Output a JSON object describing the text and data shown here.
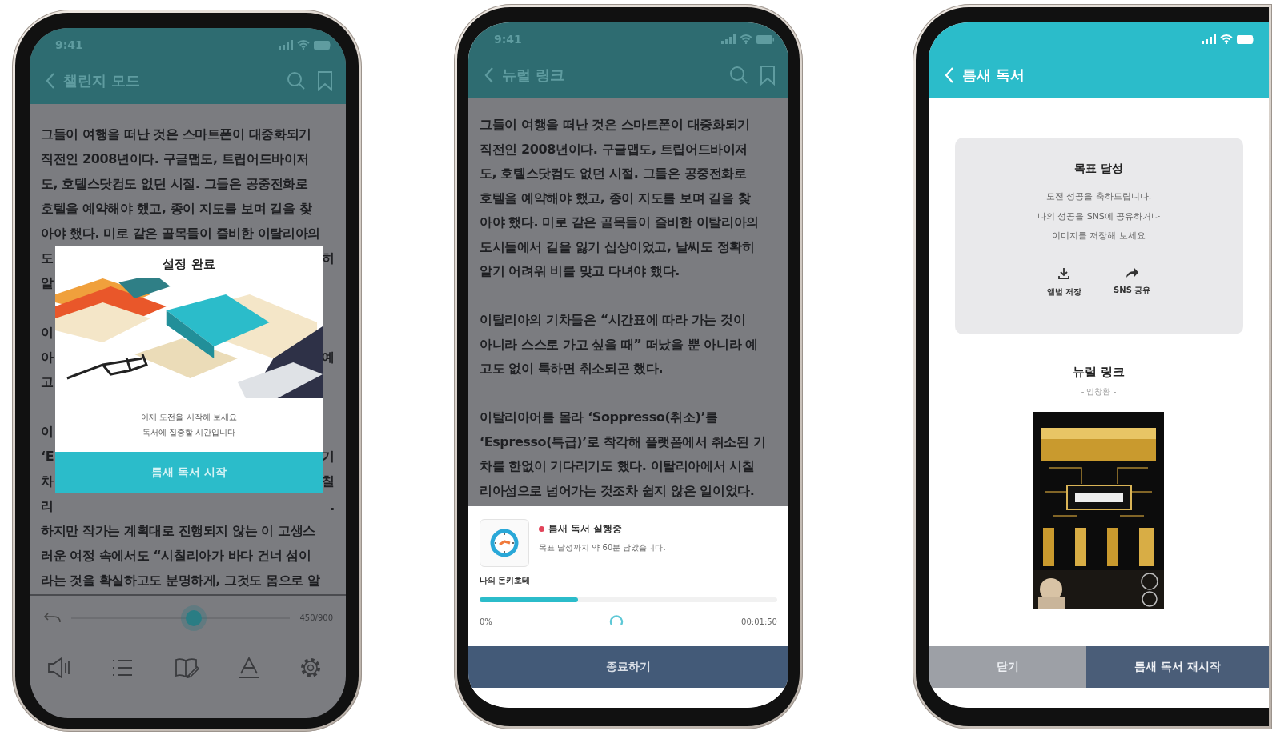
{
  "challenge_screen": {
    "status_time": "9:41",
    "title": "챌린지 모드",
    "paragraphs": [
      [
        {
          "text": "그들이 여행을 떠난 것은 스마트폰이 대중화되기"
        },
        {
          "text": "직전인 2008년이다. 구글맵도, 트립어드바이저"
        },
        {
          "text": "도, 호텔스닷컴도 없던 시절. 그들은 공중전화로"
        },
        {
          "text": "호텔을 예약해야 했고, 종이 지도를 보며 길을 찾"
        },
        {
          "text": "아야 했다. 미로 같은 골목들이 즐비한 이탈리아의"
        },
        {
          "left": "도",
          "right": "히"
        },
        {
          "left": "알"
        }
      ],
      [
        {
          "left": "이"
        },
        {
          "left": "아",
          "right": "예"
        },
        {
          "left": "고"
        }
      ],
      [
        {
          "left": "이"
        },
        {
          "left": "‘E",
          "right": "기"
        },
        {
          "left": "차",
          "right": "칠"
        },
        {
          "left": "리",
          "right": "."
        },
        {
          "text": "하지만 작가는 계획대로 진행되지 않는 이 고생스"
        },
        {
          "text": "러운 여정 속에서도 “시칠리아가 바다 건너 섬이"
        },
        {
          "text": "라는 것을 확실하고도 분명하게, 그것도 몸으로 알"
        }
      ]
    ],
    "dialog": {
      "title": "설정 완료",
      "message_lines": [
        "이제 도전을 시작해 보세요",
        "독서에 집중할 시간입니다"
      ],
      "button": "틈새 독서 시작"
    },
    "slider": {
      "level": 0.56,
      "reading": "450/900"
    }
  },
  "reading_screen": {
    "status_time": "9:41",
    "title": "뉴럴 링크",
    "paragraphs": [
      [
        {
          "text": "그들이 여행을 떠난 것은 스마트폰이 대중화되기"
        },
        {
          "text": "직전인 2008년이다. 구글맵도, 트립어드바이저"
        },
        {
          "text": "도, 호텔스닷컴도 없던 시절. 그들은 공중전화로"
        },
        {
          "text": "호텔을 예약해야 했고, 종이 지도를 보며 길을 찾"
        },
        {
          "text": "아야 했다. 미로 같은 골목들이 즐비한 이탈리아의"
        },
        {
          "text": "도시들에서 길을 잃기 십상이었고, 날씨도 정확히"
        },
        {
          "text": "알기 어려워 비를 맞고 다녀야 했다."
        }
      ],
      [
        {
          "text": "이탈리아의 기차들은 “시간표에 따라 가는 것이"
        },
        {
          "text": "아니라 스스로 가고 싶을 때” 떠났을 뿐 아니라 예"
        },
        {
          "text": "고도 없이 툭하면 취소되곤 했다."
        }
      ],
      [
        {
          "text": "이탈리아어를 몰라 ‘Soppresso(취소)’를"
        },
        {
          "text": "‘Espresso(특급)’로 착각해 플랫폼에서 취소된 기"
        },
        {
          "text": "차를 한없이 기다리기도 했다. 이탈리아에서 시칠"
        },
        {
          "text": "리아섬으로 넘어가는 것조차 쉽지 않은 일이었다."
        }
      ]
    ],
    "session": {
      "status": "틈새 독서 실행중",
      "remaining": "목표 달성까지 약 60분 남았습니다.",
      "book": "나의 돈키호테",
      "progress": {
        "level": 0.33
      },
      "start_label": "0%",
      "elapsed": "00:01:50",
      "button": "종료하기"
    }
  },
  "complete_screen": {
    "title": "틈새 독서",
    "card": {
      "title": "목표 달성",
      "message_lines": [
        "도전 성공을 축하드립니다.",
        "나의 성공을 SNS에 공유하거나",
        "이미지를 저장해 보세요"
      ],
      "actions": [
        {
          "kind": "download",
          "label": "앨범 저장"
        },
        {
          "kind": "share",
          "label": "SNS 공유"
        }
      ]
    },
    "book": {
      "title": "뉴럴 링크",
      "author": "- 임창환 -"
    },
    "buttons": [
      {
        "kind": "secondary",
        "label": "닫기"
      },
      {
        "kind": "primary",
        "label": "틈새 독서 재시작"
      }
    ]
  }
}
